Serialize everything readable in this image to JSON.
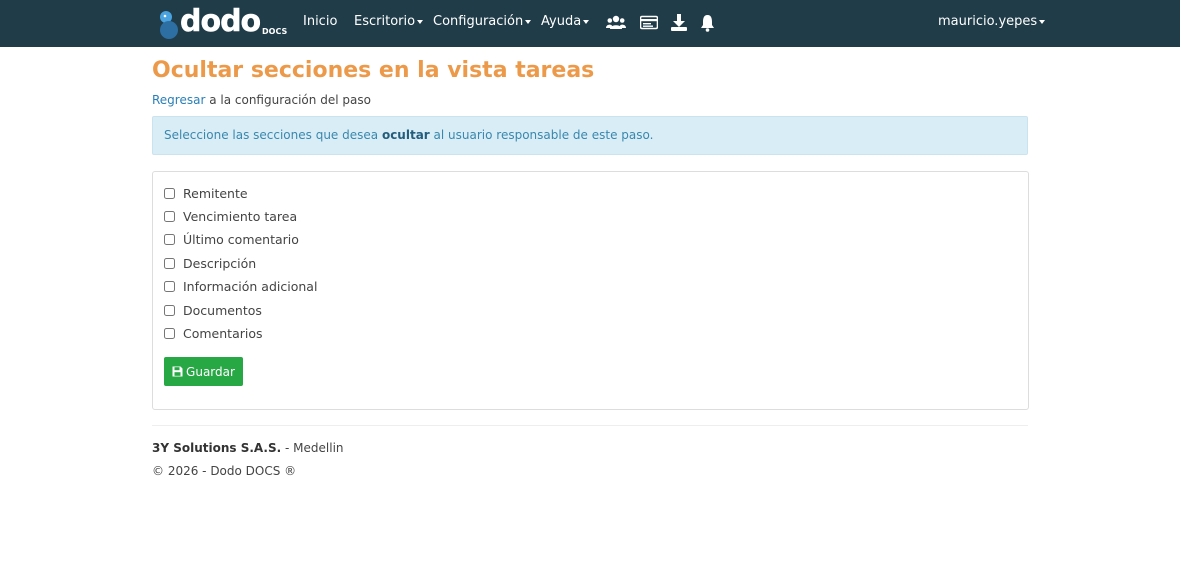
{
  "nav": {
    "logo_text": "dodo",
    "logo_sub": "DOCS",
    "items": [
      {
        "label": "Inicio",
        "has_caret": false
      },
      {
        "label": "Escritorio",
        "has_caret": true
      },
      {
        "label": "Configuración",
        "has_caret": true
      },
      {
        "label": "Ayuda",
        "has_caret": true
      }
    ],
    "icons": [
      "users-icon",
      "id-card-icon",
      "download-icon",
      "bell-icon"
    ],
    "user": "mauricio.yepes"
  },
  "page": {
    "title": "Ocultar secciones en la vista tareas",
    "back_link": "Regresar",
    "back_text": "a la configuración del paso"
  },
  "alert": {
    "prefix": "Seleccione las secciones que desea",
    "bold": "ocultar",
    "suffix": "al usuario responsable de este paso."
  },
  "sections": [
    {
      "label": "Remitente",
      "checked": false
    },
    {
      "label": "Vencimiento tarea",
      "checked": false
    },
    {
      "label": "Último comentario",
      "checked": false
    },
    {
      "label": "Descripción",
      "checked": false
    },
    {
      "label": "Información adicional",
      "checked": false
    },
    {
      "label": "Documentos",
      "checked": false
    },
    {
      "label": "Comentarios",
      "checked": false
    }
  ],
  "save_label": "Guardar",
  "footer": {
    "company": "3Y Solutions S.A.S.",
    "city": "- Medellin",
    "copyright": "© 2026 - Dodo DOCS ®"
  },
  "colors": {
    "navbar": "#1f3c48",
    "title": "#ec9a4a",
    "save_button": "#28a745",
    "alert_bg": "#d9edf7"
  }
}
